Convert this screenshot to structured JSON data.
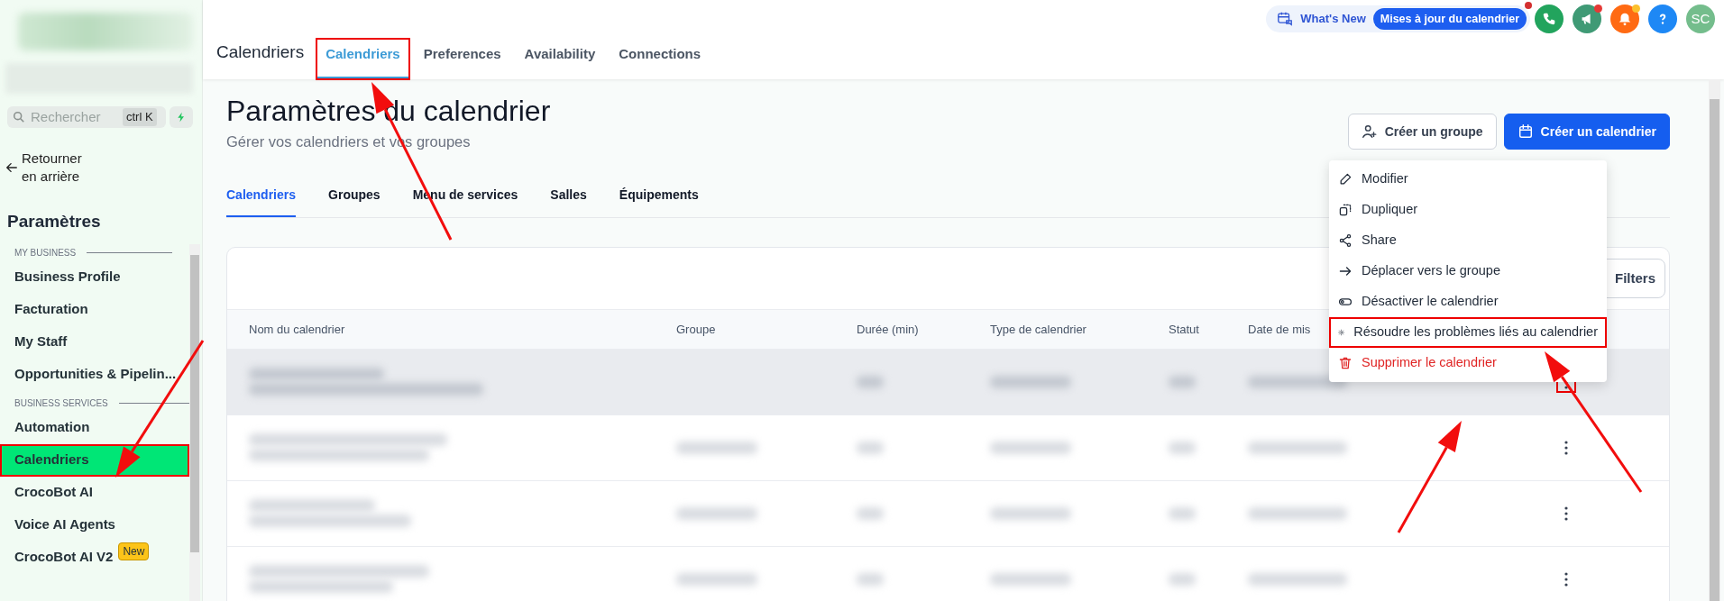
{
  "sidebar": {
    "search": {
      "placeholder": "Rechercher",
      "shortcut": "ctrl K"
    },
    "back_link": "Retourner en arrière",
    "heading": "Paramètres",
    "sections": [
      {
        "label": "MY BUSINESS",
        "items": [
          {
            "label": "Business Profile",
            "selected": false,
            "annotated": false
          },
          {
            "label": "Facturation",
            "selected": false,
            "annotated": false
          },
          {
            "label": "My Staff",
            "selected": false,
            "annotated": false
          },
          {
            "label": "Opportunities & Pipelin...",
            "selected": false,
            "annotated": false
          }
        ]
      },
      {
        "label": "BUSINESS SERVICES",
        "items": [
          {
            "label": "Automation",
            "selected": false,
            "annotated": false
          },
          {
            "label": "Calendriers",
            "selected": true,
            "annotated": true
          },
          {
            "label": "CrocoBot AI",
            "selected": false,
            "annotated": false
          },
          {
            "label": "Voice AI Agents",
            "selected": false,
            "annotated": false
          },
          {
            "label": "CrocoBot AI V2",
            "selected": false,
            "annotated": false,
            "badge": "New"
          }
        ]
      }
    ]
  },
  "topbar": {
    "whats_new": "What's New",
    "update_pill": "Mises à jour du calendrier",
    "avatar": "SC"
  },
  "header": {
    "title": "Calendriers",
    "tabs": [
      {
        "label": "Calendriers",
        "selected": true,
        "annotated": true
      },
      {
        "label": "Preferences",
        "selected": false,
        "annotated": false
      },
      {
        "label": "Availability",
        "selected": false,
        "annotated": false
      },
      {
        "label": "Connections",
        "selected": false,
        "annotated": false
      }
    ]
  },
  "page": {
    "title": "Paramètres du calendrier",
    "subtitle": "Gérer vos calendriers et vos groupes",
    "buttons": [
      {
        "label": "Créer un groupe",
        "kind": "secondary"
      },
      {
        "label": "Créer un calendrier",
        "kind": "primary"
      }
    ],
    "tabs": [
      {
        "label": "Calendriers",
        "selected": true
      },
      {
        "label": "Groupes",
        "selected": false
      },
      {
        "label": "Menu de services",
        "selected": false
      },
      {
        "label": "Salles",
        "selected": false
      },
      {
        "label": "Équipements",
        "selected": false
      }
    ]
  },
  "table": {
    "filters_button": "Filters",
    "columns": [
      "Nom du calendrier",
      "Groupe",
      "Durée (min)",
      "Type de calendrier",
      "Statut",
      "Date de mis"
    ],
    "rows": [
      {
        "highlighted": true,
        "menu_annotated": true
      },
      {
        "highlighted": false,
        "menu_annotated": false
      },
      {
        "highlighted": false,
        "menu_annotated": false
      },
      {
        "highlighted": false,
        "menu_annotated": false
      }
    ]
  },
  "context_menu": {
    "items": [
      {
        "label": "Modifier",
        "danger": false,
        "annotated": false
      },
      {
        "label": "Dupliquer",
        "danger": false,
        "annotated": false
      },
      {
        "label": "Share",
        "danger": false,
        "annotated": false
      },
      {
        "label": "Déplacer vers le groupe",
        "danger": false,
        "annotated": false
      },
      {
        "label": "Désactiver le calendrier",
        "danger": false,
        "annotated": false
      },
      {
        "label": "Résoudre les problèmes liés au calendrier",
        "danger": false,
        "annotated": true
      },
      {
        "label": "Supprimer le calendrier",
        "danger": true,
        "annotated": false
      }
    ]
  }
}
